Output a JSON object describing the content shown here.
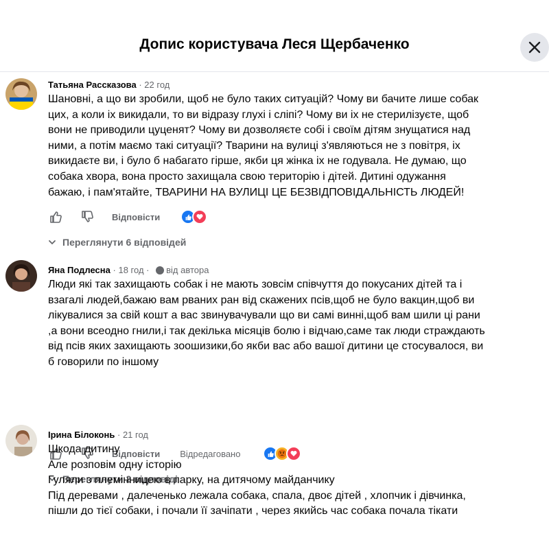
{
  "header": {
    "title": "Допис користувача Леся Щербаченко"
  },
  "comments": [
    {
      "author": "Татьяна Рассказова",
      "separator": "·",
      "time": "22 год",
      "lines": [
        "Шановні, а що ви зробили, щоб не було таких ситуацій? Чому ви бачите лише собак",
        "цих, а коли іх викидали, то ви відразу глухі і сліпі? Чому ви іх не стерилізуєте, щоб",
        "вони не приводили цуценят? Чому ви дозволяєте собі і своїм дітям знущатися над",
        "ними, а потім маємо такі ситуації? Тварини на вулиці з'являються не з повітря, іх",
        "викидаєте ви, і було б набагато гірше, якби ця жінка іх не годувала. Не думаю, що",
        "собака хвора, вона просто захищала свою територію і дітей. Дитині одужання",
        "бажаю, і пам'ятайте, ТВАРИНИ НА ВУЛИЦІ ЦЕ БЕЗВІДПОВІДАЛЬНІСТЬ ЛЮДЕЙ!"
      ],
      "reply_label": "Відповісти",
      "reactions": [
        "like",
        "love"
      ],
      "view_replies": "Переглянути 6 відповідей"
    },
    {
      "author": "Яна Подлесна",
      "separator": "·",
      "time": "18 год",
      "author_badge": "від автора",
      "lines": [
        "Люди які так захищають собак і не мають зовсім співчуття до покусаних дітей та і",
        "взагалі людей,бажаю вам рваних ран від скажених псів,щоб не було вакцин,щоб ви",
        "лікувалися за свій кошт а вас звинувачували що ви самі винні,щоб вам шили ці рани",
        ",а вони всеодно гнили,і так декілька місяців болю і відчаю,саме так люди страждають",
        "від псів яких захищають зоошизики,бо якби вас або вашої дитини це стосувалося, ви",
        "б говорили по іншому"
      ],
      "reply_label": "Відповісти",
      "edited_label": "Відредаговано",
      "reactions": [
        "like",
        "angry",
        "love"
      ],
      "view_replies": "Переглянути 2 відповіді"
    },
    {
      "author": "Ірина Білоконь",
      "separator": "·",
      "time": "21 год",
      "lines": [
        "Шкода дитину",
        "Але розповім одну історію",
        "Гуляли з племінницею в парку, на дитячому майданчику",
        "Під деревами , далеченько лежала собака, спала, двоє дітей , хлопчик і дівчинка,",
        "пішли до тієї собаки, і почали її зачіпати , через якийсь час собака почала тікати"
      ]
    }
  ],
  "colors": {
    "like": "#1877f2",
    "love": "#f33e58",
    "angry": "#f7b125",
    "secondary_text": "#65676b",
    "close_bg": "#e4e6eb"
  }
}
